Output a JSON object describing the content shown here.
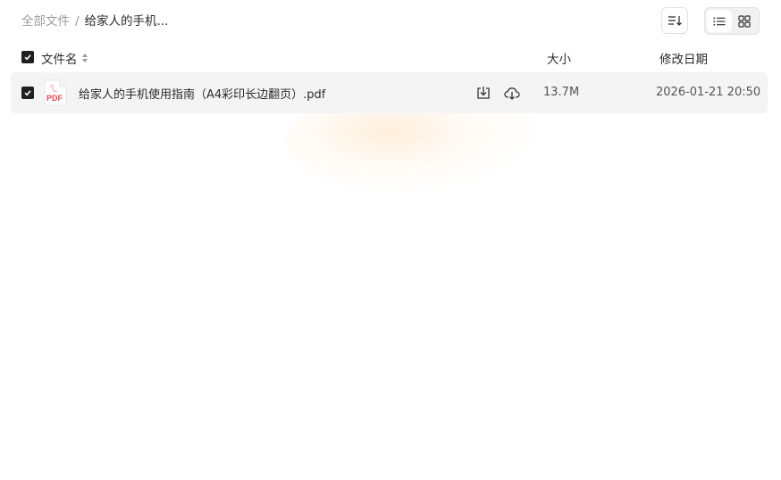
{
  "breadcrumb": {
    "root": "全部文件",
    "separator": "/",
    "current": "给家人的手机..."
  },
  "toolbar": {
    "sort_icon": "sort-icon",
    "list_view_icon": "list-view-icon",
    "grid_view_icon": "grid-view-icon",
    "active_view": "list"
  },
  "table": {
    "columns": {
      "name": "文件名",
      "size": "大小",
      "modified": "修改日期"
    },
    "header_checked": true,
    "rows": [
      {
        "checked": true,
        "icon": "pdf-file-icon",
        "icon_label": "PDF",
        "name": "给家人的手机使用指南（A4彩印长边翻页）.pdf",
        "size": "13.7M",
        "modified": "2026-01-21 20:50"
      }
    ]
  },
  "colors": {
    "row_bg": "#f4f4f4",
    "pdf_red": "#e8484e",
    "checkbox": "#1f1f1f"
  }
}
